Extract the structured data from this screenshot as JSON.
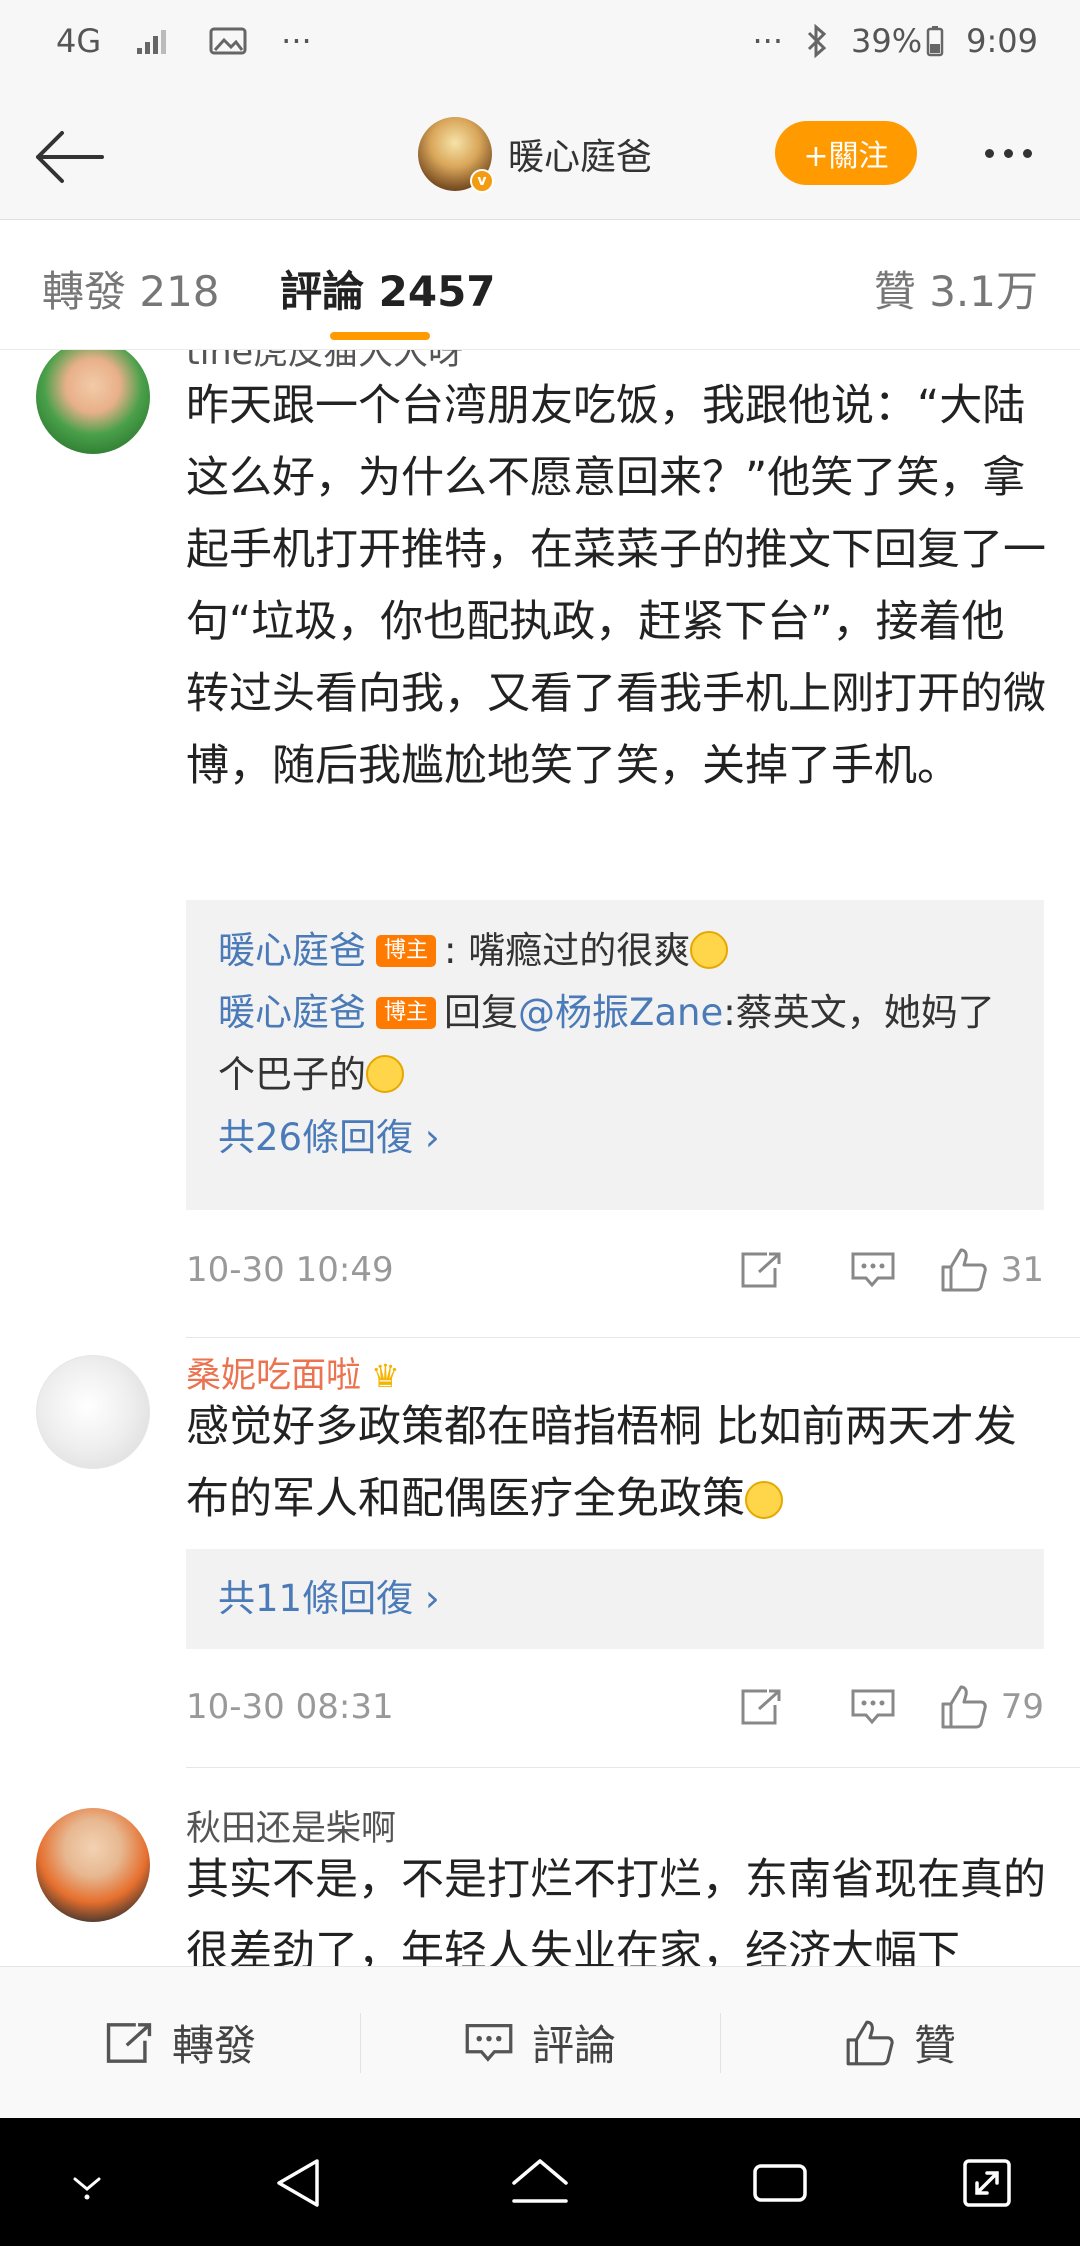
{
  "status_bar": {
    "network": "4G",
    "more": "···",
    "right_more": "···",
    "battery": "39%",
    "time": "9:09"
  },
  "nav": {
    "title": "暖心庭爸",
    "follow_label": "+關注"
  },
  "tabs": {
    "repost": "轉發 218",
    "comment": "評論 2457",
    "like": "贊 3.1万"
  },
  "comments": [
    {
      "username": "tine虎皮猫大大呀",
      "text": "昨天跟一个台湾朋友吃饭，我跟他说：“大陆这么好，为什么不愿意回来？”他笑了笑，拿起手机打开推特，在菜菜子的推文下回复了一句“垃圾，你也配执政，赶紧下台”，接着他转过头看向我，又看了看我手机上刚打开的微博，随后我尴尬地笑了笑，关掉了手机。",
      "replies": [
        {
          "name": "暖心庭爸",
          "badge": "博主",
          "text": ": 嘴瘾过的很爽"
        },
        {
          "name": "暖心庭爸",
          "badge": "博主",
          "prefix": "回复",
          "mention": "@杨振Zane",
          "text": ":蔡英文，她妈了个巴子的"
        }
      ],
      "more_replies": "共26條回復 ›",
      "time": "10-30 10:49",
      "likes": "31"
    },
    {
      "username": "桑妮吃面啦",
      "text": "感觉好多政策都在暗指梧桐 比如前两天才发布的军人和配偶医疗全免政策",
      "more_replies": "共11條回復 ›",
      "time": "10-30 08:31",
      "likes": "79"
    },
    {
      "username": "秋田还是柴啊",
      "text": "其实不是，不是打烂不打烂，东南省现在真的很差劲了，年轻人失业在家，经济大幅下"
    }
  ],
  "bottom_bar": {
    "repost": "轉發",
    "comment": "評論",
    "like": "贊"
  },
  "colors": {
    "accent": "#ff9a00",
    "link": "#4a7ab8",
    "vip_name": "#eb7350",
    "op_badge": "#ff7a00"
  }
}
